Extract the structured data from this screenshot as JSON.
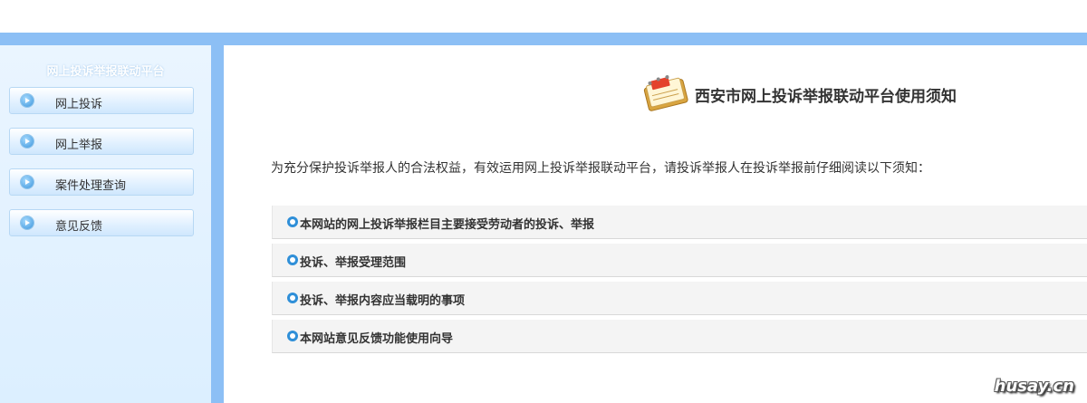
{
  "sidebar": {
    "title": "网上投诉举报联动平台",
    "items": [
      {
        "label": "网上投诉"
      },
      {
        "label": "网上举报"
      },
      {
        "label": "案件处理查询"
      },
      {
        "label": "意见反馈"
      }
    ]
  },
  "main": {
    "title": "西安市网上投诉举报联动平台使用须知",
    "intro": "为充分保护投诉举报人的合法权益，有效运用网上投诉举报联动平台，请投诉举报人在投诉举报前仔细阅读以下须知：",
    "notices": [
      {
        "label": "本网站的网上投诉举报栏目主要接受劳动者的投诉、举报"
      },
      {
        "label": "投诉、举报受理范围"
      },
      {
        "label": "投诉、举报内容应当载明的事项"
      },
      {
        "label": "本网站意见反馈功能使用向导"
      }
    ]
  },
  "watermark": "husay.cn",
  "colors": {
    "accent": "#8cbff5",
    "sidebar_bg": "#e3f2ff",
    "bullet": "#2f8fd8"
  }
}
